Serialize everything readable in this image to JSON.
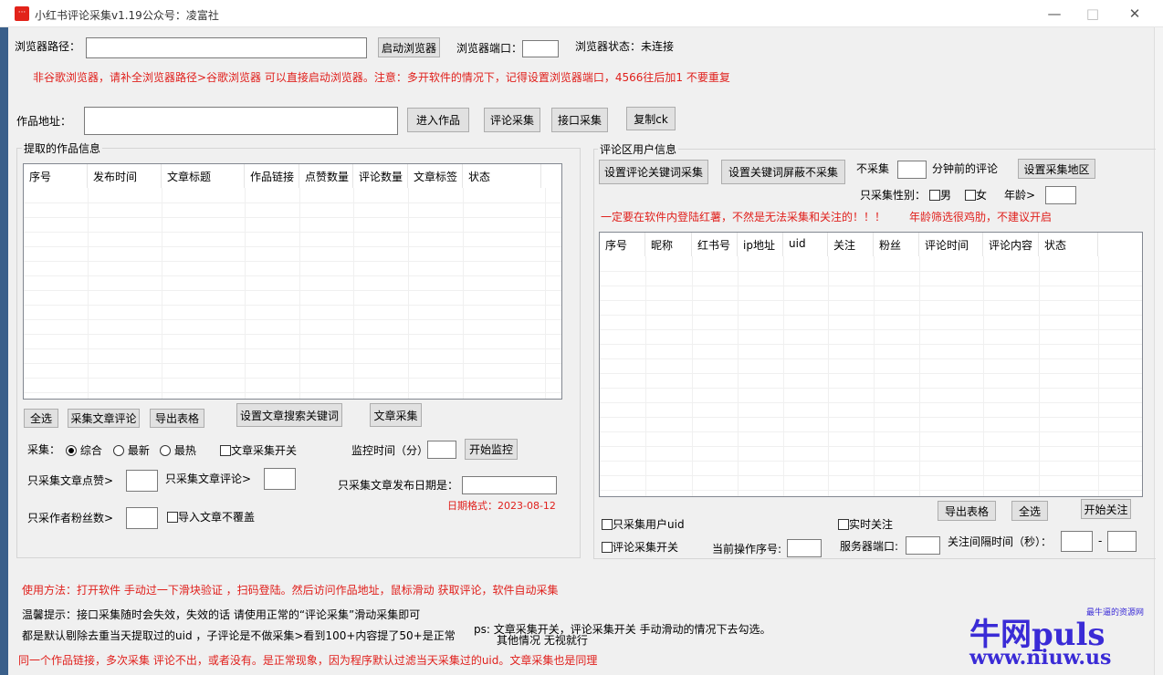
{
  "window": {
    "title": "小红书评论采集v1.19公众号：凌富社",
    "app_icon": "xiaohongshu-icon",
    "minimize_icon": "minimize-icon",
    "maximize_icon": "maximize-icon",
    "close_icon": "close-icon"
  },
  "browser": {
    "path_label": "浏览器路径：",
    "path_value": "",
    "start_button": "启动浏览器",
    "port_label": "浏览器端口：",
    "port_value": "",
    "status_label": "浏览器状态：",
    "status_value": "未连接",
    "note": "非谷歌浏览器，请补全浏览器路径>谷歌浏览器 可以直接启动浏览器。注意：多开软件的情况下，记得设置浏览器端口，4566往后加1  不要重复"
  },
  "work": {
    "address_label": "作品地址：",
    "address_value": "",
    "enter_button": "进入作品",
    "comment_collect_button": "评论采集",
    "api_collect_button": "接口采集",
    "copy_ck_button": "复制ck"
  },
  "left_panel": {
    "group_title": "提取的作品信息",
    "columns": [
      "序号",
      "发布时间",
      "文章标题",
      "作品链接",
      "点赞数量",
      "评论数量",
      "文章标签",
      "状态"
    ],
    "select_all_button": "全选",
    "collect_comments_button": "采集文章评论",
    "export_button": "导出表格",
    "set_keyword_button": "设置文章搜索关键词",
    "article_collect_button": "文章采集",
    "collect_label": "采集：",
    "sort_options": [
      "综合",
      "最新",
      "最热"
    ],
    "sort_selected": "综合",
    "article_switch_label": "文章采集开关",
    "monitor_time_label": "监控时间（分）",
    "monitor_time_value": "",
    "start_monitor_button": "开始监控",
    "min_likes_label": "只采集文章点赞>",
    "min_likes_value": "",
    "min_comments_label": "只采集文章评论>",
    "min_comments_value": "",
    "publish_date_label": "只采集文章发布日期是：",
    "publish_date_value": "",
    "date_format_hint": "日期格式：2023-08-12",
    "min_fans_label": "只采作者粉丝数>",
    "min_fans_value": "",
    "no_overwrite_label": "导入文章不覆盖"
  },
  "right_panel": {
    "group_title": "评论区用户信息",
    "set_keyword_button": "设置评论关键词采集",
    "set_block_button": "设置关键词屏蔽不采集",
    "skip_label": "不采集",
    "skip_minutes_value": "",
    "minutes_label": "分钟前的评论",
    "set_region_button": "设置采集地区",
    "gender_label": "只采集性别：",
    "gender_male": "男",
    "gender_female": "女",
    "age_label": "年龄>",
    "age_value": "",
    "warning": "一定要在软件内登陆红薯，不然是无法采集和关注的！！！",
    "age_warning": "年龄筛选很鸡肋，不建议开启",
    "columns": [
      "序号",
      "昵称",
      "红书号",
      "ip地址",
      "uid",
      "关注",
      "粉丝",
      "评论时间",
      "评论内容",
      "状态"
    ],
    "export_button": "导出表格",
    "select_all_button": "全选",
    "start_follow_button": "开始关注",
    "only_uid_label": "只采集用户uid",
    "realtime_follow_label": "实时关注",
    "comment_switch_label": "评论采集开关",
    "current_index_label": "当前操作序号:",
    "current_index_value": "",
    "server_port_label": "服务器端口:",
    "server_port_value": "",
    "follow_interval_label": "关注间隔时间（秒）：",
    "interval_from": "",
    "interval_sep": "-",
    "interval_to": ""
  },
  "footer": {
    "usage": "使用方法：打开软件 手动过一下滑块验证  ，扫码登陆。然后访问作品地址，鼠标滑动 获取评论，软件自动采集",
    "tip1": "温馨提示：接口采集随时会失效，失效的话 请使用正常的“评论采集”滑动采集即可",
    "tip2": "都是默认剔除去重当天提取过的uid ，子评论是不做采集>看到100+内容提了50+是正常",
    "ps1": "ps: 文章采集开关，评论采集开关 手动滑动的情况下去勾选。",
    "ps2": "其他情况 无视就行",
    "note": "同一个作品链接，多次采集  评论不出，或者没有。是正常现象，因为程序默认过滤当天采集过的uid。文章采集也是同理"
  },
  "watermark": {
    "brand": "牛网puls",
    "tagline": "最牛逼的资源网",
    "url": "www.niuw.us"
  },
  "colors": {
    "accent_red": "#e0201c",
    "watermark_blue": "#3a2bd6"
  }
}
